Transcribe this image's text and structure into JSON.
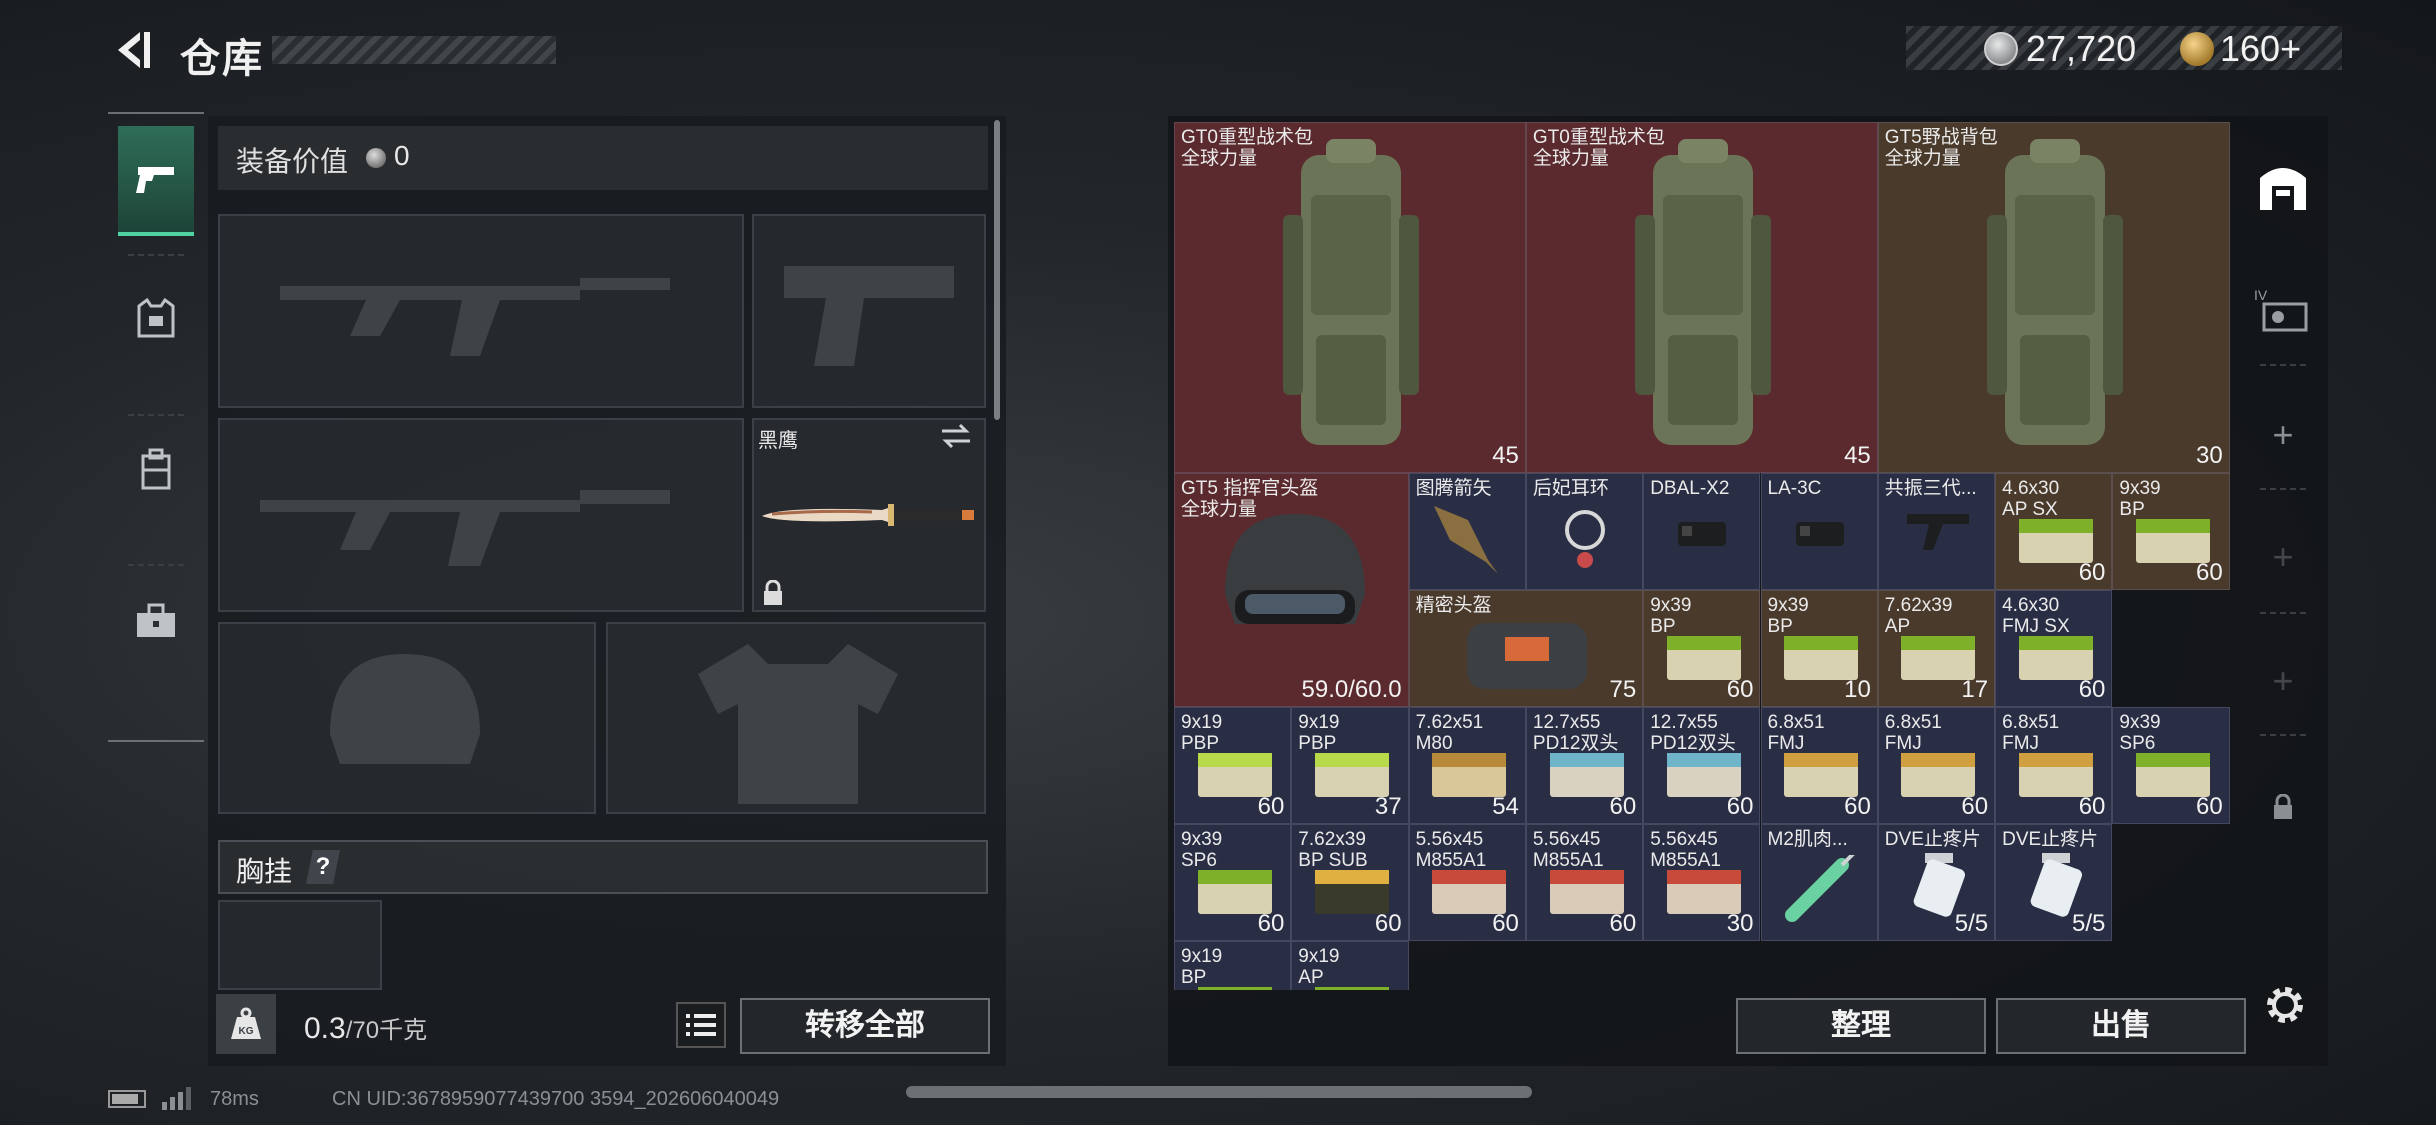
{
  "header": {
    "title": "仓库",
    "coins": "27,720",
    "gold": "160+"
  },
  "equip": {
    "value_label": "装备价值",
    "value": "0",
    "knife_name": "黑鹰",
    "rig_label": "胸挂",
    "rig_help": "?",
    "weight": "0.3",
    "weight_max": "/70千克",
    "transfer_all": "转移全部"
  },
  "stash": {
    "sort": "整理",
    "sell": "出售",
    "items": [
      {
        "name": "GT0重型战术包\n全球力量",
        "qty": "45",
        "color": "red"
      },
      {
        "name": "GT0重型战术包\n全球力量",
        "qty": "45",
        "color": "red"
      },
      {
        "name": "GT5野战背包\n全球力量",
        "qty": "30",
        "color": "brown"
      },
      {
        "name": "GT5 指挥官头盔\n全球力量",
        "qty": "59.0/60.0",
        "color": "red"
      },
      {
        "name": "图腾箭矢",
        "qty": "",
        "color": "blue"
      },
      {
        "name": "后妃耳环",
        "qty": "",
        "color": "blue"
      },
      {
        "name": "DBAL-X2",
        "qty": "",
        "color": "blue"
      },
      {
        "name": "LA-3C",
        "qty": "",
        "color": "blue"
      },
      {
        "name": "共振三代...",
        "qty": "",
        "color": "blue"
      },
      {
        "name": "4.6x30\nAP SX",
        "qty": "60",
        "color": "brown"
      },
      {
        "name": "9x39\nBP",
        "qty": "60",
        "color": "brown"
      },
      {
        "name": "精密头盔",
        "qty": "75",
        "color": "brown"
      },
      {
        "name": "9x39\nBP",
        "qty": "60",
        "color": "brown"
      },
      {
        "name": "9x39\nBP",
        "qty": "10",
        "color": "brown"
      },
      {
        "name": "7.62x39\nAP",
        "qty": "17",
        "color": "brown"
      },
      {
        "name": "4.6x30\nFMJ SX",
        "qty": "60",
        "color": "blue"
      },
      {
        "name": "9x19\nPBP",
        "qty": "60",
        "color": "blue"
      },
      {
        "name": "9x19\nPBP",
        "qty": "37",
        "color": "blue"
      },
      {
        "name": "7.62x51\nM80",
        "qty": "54",
        "color": "blue"
      },
      {
        "name": "12.7x55\nPD12双头",
        "qty": "60",
        "color": "blue"
      },
      {
        "name": "12.7x55\nPD12双头",
        "qty": "60",
        "color": "blue"
      },
      {
        "name": "6.8x51\nFMJ",
        "qty": "60",
        "color": "blue"
      },
      {
        "name": "6.8x51\nFMJ",
        "qty": "60",
        "color": "blue"
      },
      {
        "name": "6.8x51\nFMJ",
        "qty": "60",
        "color": "blue"
      },
      {
        "name": "9x39\nSP6",
        "qty": "60",
        "color": "blue"
      },
      {
        "name": "9x39\nSP6",
        "qty": "60",
        "color": "blue"
      },
      {
        "name": "7.62x39\nBP SUB",
        "qty": "60",
        "color": "blue"
      },
      {
        "name": "5.56x45\nM855A1",
        "qty": "60",
        "color": "blue"
      },
      {
        "name": "5.56x45\nM855A1",
        "qty": "60",
        "color": "blue"
      },
      {
        "name": "5.56x45\nM855A1",
        "qty": "30",
        "color": "blue"
      },
      {
        "name": "M2肌肉...",
        "qty": "",
        "color": "blue"
      },
      {
        "name": "DVE止疼片",
        "qty": "5/5",
        "color": "blue"
      },
      {
        "name": "DVE止疼片",
        "qty": "5/5",
        "color": "blue"
      },
      {
        "name": "9x19\nBP",
        "qty": "",
        "color": "blue"
      },
      {
        "name": "9x19\nAP",
        "qty": "",
        "color": "blue"
      }
    ]
  },
  "status": {
    "ping": "78ms",
    "uid": "CN UID:3678959077439700 3594_202606040049"
  },
  "colors": {
    "accent": "#4fd1a2",
    "cell_red": "#5b2a2e",
    "cell_brown": "#4a3a2c",
    "cell_blue": "#2a2e45"
  }
}
